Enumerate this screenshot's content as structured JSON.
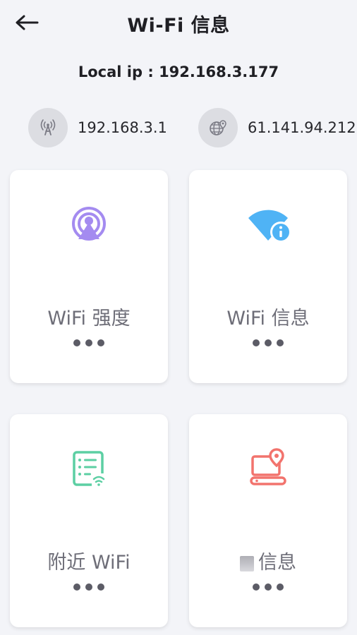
{
  "header": {
    "title": "Wi-Fi 信息",
    "back_icon": "arrow-left-icon"
  },
  "local_ip": "Local ip : 192.168.3.177",
  "gateway": {
    "icon": "antenna-icon",
    "value": "192.168.3.1"
  },
  "public_ip": {
    "icon": "globe-pin-icon",
    "value": "61.141.94.212"
  },
  "cards": [
    {
      "label": "WiFi 强度",
      "icon": "signal-broadcast-icon",
      "color": "#a48bf0"
    },
    {
      "label": "WiFi 信息",
      "icon": "wifi-info-icon",
      "color": "#4fb3f5"
    },
    {
      "label": "附近 WiFi",
      "icon": "wifi-list-icon",
      "color": "#5ccfa3"
    },
    {
      "label": "信息",
      "icon": "device-location-icon",
      "color": "#f2736d"
    }
  ],
  "colors": {
    "background": "#f3f4f8",
    "card": "#ffffff",
    "pill": "#dcdde2"
  }
}
